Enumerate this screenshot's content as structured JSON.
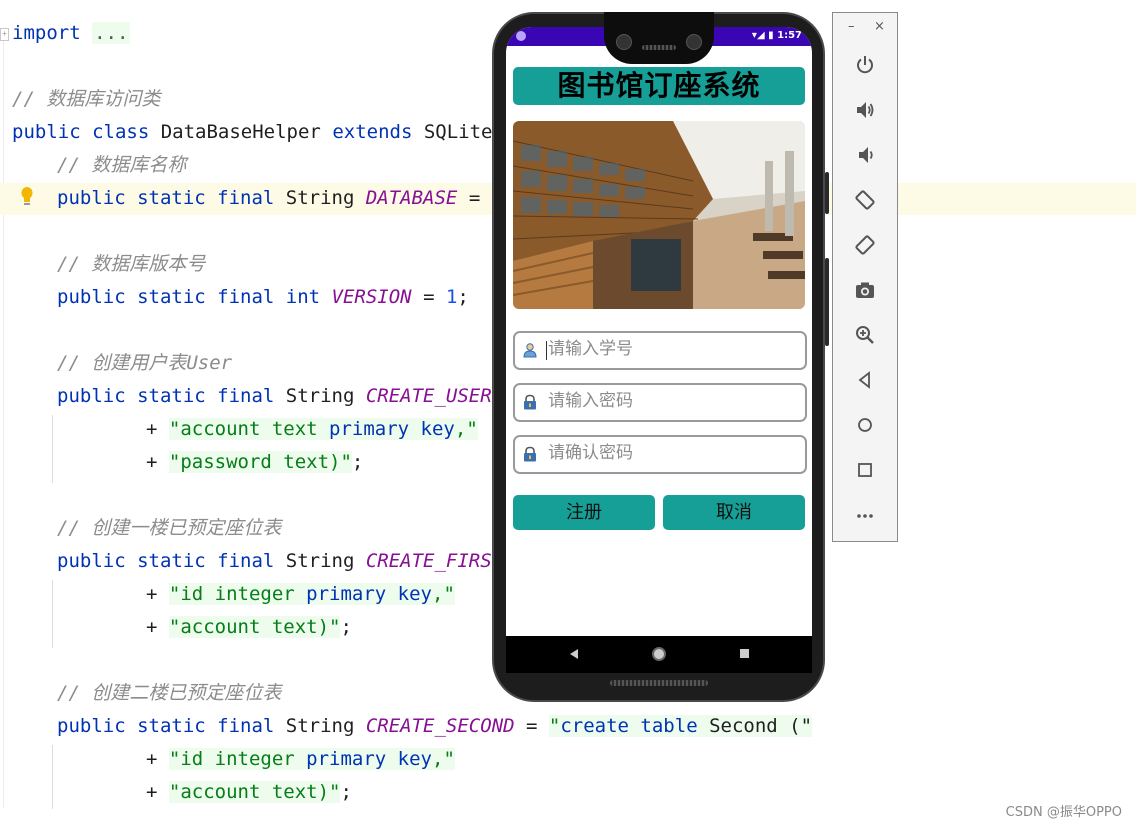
{
  "editor": {
    "lines": [
      [
        "import ",
        "..."
      ],
      [
        "// 数据库访问类"
      ],
      [
        "public class ",
        "DataBaseHelper ",
        "extends ",
        "SQLiteO"
      ],
      [
        "// 数据库名称"
      ],
      [
        "public static final ",
        "String ",
        "DATABASE",
        " = ",
        "\""
      ],
      [
        "// 数据库版本号"
      ],
      [
        "public static final int ",
        "VERSION",
        " = ",
        "1",
        ";"
      ],
      [
        "// 创建用户表User"
      ],
      [
        "public static final ",
        "String ",
        "CREATE_USER"
      ],
      [
        "+ ",
        "\"account text ",
        "primary key",
        ",\""
      ],
      [
        "+ ",
        "\"password text)\"",
        ";"
      ],
      [
        "// 创建一楼已预定座位表"
      ],
      [
        "public static final ",
        "String ",
        "CREATE_FIRST"
      ],
      [
        "+ ",
        "\"id integer ",
        "primary key",
        ",\""
      ],
      [
        "+ ",
        "\"account text)\"",
        ";"
      ],
      [
        "// 创建二楼已预定座位表"
      ],
      [
        "public static final ",
        "String ",
        "CREATE_SECOND",
        " = ",
        "\"",
        "create table ",
        "Second (\""
      ],
      [
        "+ ",
        "\"id integer ",
        "primary key",
        ",\""
      ],
      [
        "+ ",
        "\"account text)\"",
        ";"
      ]
    ],
    "colors": {
      "keyword": "#0033b3",
      "comment": "#8c8c8c",
      "field": "#871094",
      "number": "#1750eb",
      "string": "#067d17",
      "string_bg": "#edfced"
    }
  },
  "phone": {
    "status_time": "1:57",
    "app_title": "图书馆订座系统",
    "fields": {
      "student_id_placeholder": "请输入学号",
      "password_placeholder": "请输入密码",
      "confirm_password_placeholder": "请确认密码"
    },
    "buttons": {
      "register": "注册",
      "cancel": "取消"
    },
    "accent_color": "#159f97",
    "statusbar_color": "#3a06b3"
  },
  "emulator_toolbar": {
    "minimize": "–",
    "close": "×",
    "icons": [
      "power-icon",
      "volume-up-icon",
      "volume-down-icon",
      "rotate-left-icon",
      "rotate-right-icon",
      "camera-icon",
      "zoom-icon",
      "back-icon",
      "home-icon",
      "overview-icon",
      "more-icon"
    ]
  },
  "watermark": "CSDN @振华OPPO"
}
